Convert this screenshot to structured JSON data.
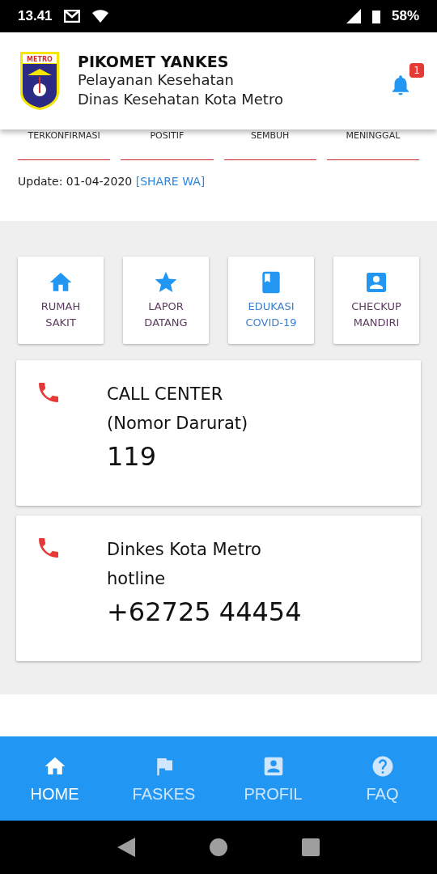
{
  "status_bar": {
    "time": "13.41",
    "battery": "58%"
  },
  "header": {
    "title": "PIKOMET YANKES",
    "subtitle_1": "Pelayanan Kesehatan",
    "subtitle_2": "Dinas Kesehatan Kota Metro",
    "logo_text": "METRO",
    "notification_count": "1"
  },
  "stats": [
    {
      "label": "TERKONFIRMASI"
    },
    {
      "label": "POSITIF"
    },
    {
      "label": "SEMBUH"
    },
    {
      "label": "MENINGGAL"
    }
  ],
  "update": {
    "text": "Update: 01-04-2020",
    "link": "[SHARE WA]"
  },
  "menu": [
    {
      "kind": "home",
      "line_1": "RUMAH",
      "line_2": "SAKIT",
      "color": "#5b3a5e"
    },
    {
      "kind": "star",
      "line_1": "LAPOR",
      "line_2": "DATANG",
      "color": "#5b3a5e"
    },
    {
      "kind": "book",
      "line_1": "EDUKASI",
      "line_2": "COVID-19",
      "color": "#3b7fd0"
    },
    {
      "kind": "person",
      "line_1": "CHECKUP",
      "line_2": "MANDIRI",
      "color": "#5b3a5e"
    }
  ],
  "contacts": [
    {
      "line_1": "CALL CENTER",
      "line_2": "(Nomor Darurat)",
      "number": "119"
    },
    {
      "line_1": "Dinkes Kota Metro",
      "line_2": "hotline",
      "number": "+62725 44454"
    }
  ],
  "bottom_nav": [
    {
      "kind": "home",
      "label": "HOME",
      "selected": true
    },
    {
      "kind": "flag",
      "label": "FASKES",
      "selected": false
    },
    {
      "kind": "person",
      "label": "PROFIL",
      "selected": false
    },
    {
      "kind": "help",
      "label": "FAQ",
      "selected": false
    }
  ]
}
